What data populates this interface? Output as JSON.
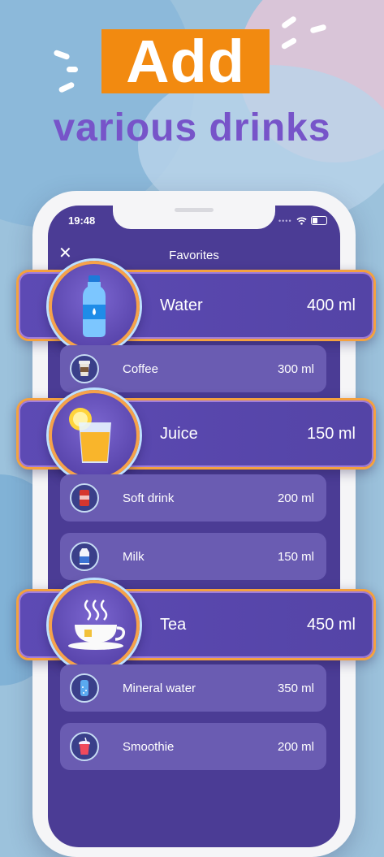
{
  "headline": {
    "title": "Add",
    "subtitle": "various drinks"
  },
  "status_bar": {
    "time": "19:48",
    "signal": "••••"
  },
  "nav": {
    "title": "Favorites",
    "close_glyph": "✕"
  },
  "featured": [
    {
      "name": "Water",
      "amount": "400 ml",
      "icon": "water-bottle-icon"
    },
    {
      "name": "Juice",
      "amount": "150 ml",
      "icon": "juice-glass-icon"
    },
    {
      "name": "Tea",
      "amount": "450 ml",
      "icon": "tea-cup-icon"
    }
  ],
  "drinks": [
    {
      "name": "Coffee",
      "amount": "300 ml",
      "icon": "coffee-cup-icon"
    },
    {
      "name": "Soft drink",
      "amount": "200 ml",
      "icon": "soda-can-icon"
    },
    {
      "name": "Milk",
      "amount": "150 ml",
      "icon": "milk-carton-icon"
    },
    {
      "name": "Mineral water",
      "amount": "350 ml",
      "icon": "mineral-water-icon"
    },
    {
      "name": "Smoothie",
      "amount": "200 ml",
      "icon": "smoothie-icon"
    }
  ],
  "colors": {
    "accent": "#f28a10",
    "headline_text": "#7754c9",
    "list_bg": "#4b3c95",
    "row_bg": "#6a5cb2",
    "highlight_border": "#f4a13f"
  }
}
